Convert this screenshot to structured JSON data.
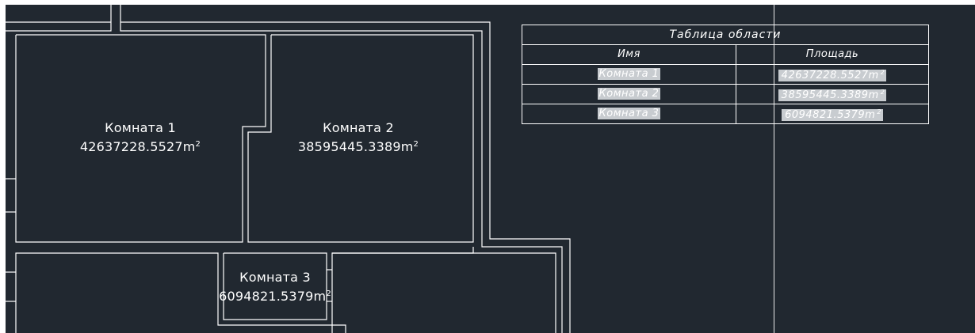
{
  "colors": {
    "background": "#212830",
    "lines": "#ffffff",
    "highlight": "#c8ccd0"
  },
  "rooms": [
    {
      "name": "Комната 1",
      "area": "42637228.5527m",
      "area_sup": "2"
    },
    {
      "name": "Комната 2",
      "area": "38595445.3389m",
      "area_sup": "2"
    },
    {
      "name": "Комната 3",
      "area": "6094821.5379m",
      "area_sup": "2"
    }
  ],
  "area_table": {
    "title": "Таблица области",
    "headers": {
      "name": "Имя",
      "area": "Площадь"
    },
    "rows": [
      {
        "name": "Комната 1",
        "area": "42637228.5527m",
        "area_sup": "2"
      },
      {
        "name": "Комната 2",
        "area": "38595445.3389m",
        "area_sup": "2"
      },
      {
        "name": "Комната 3",
        "area": "6094821.5379m",
        "area_sup": "2"
      }
    ]
  }
}
